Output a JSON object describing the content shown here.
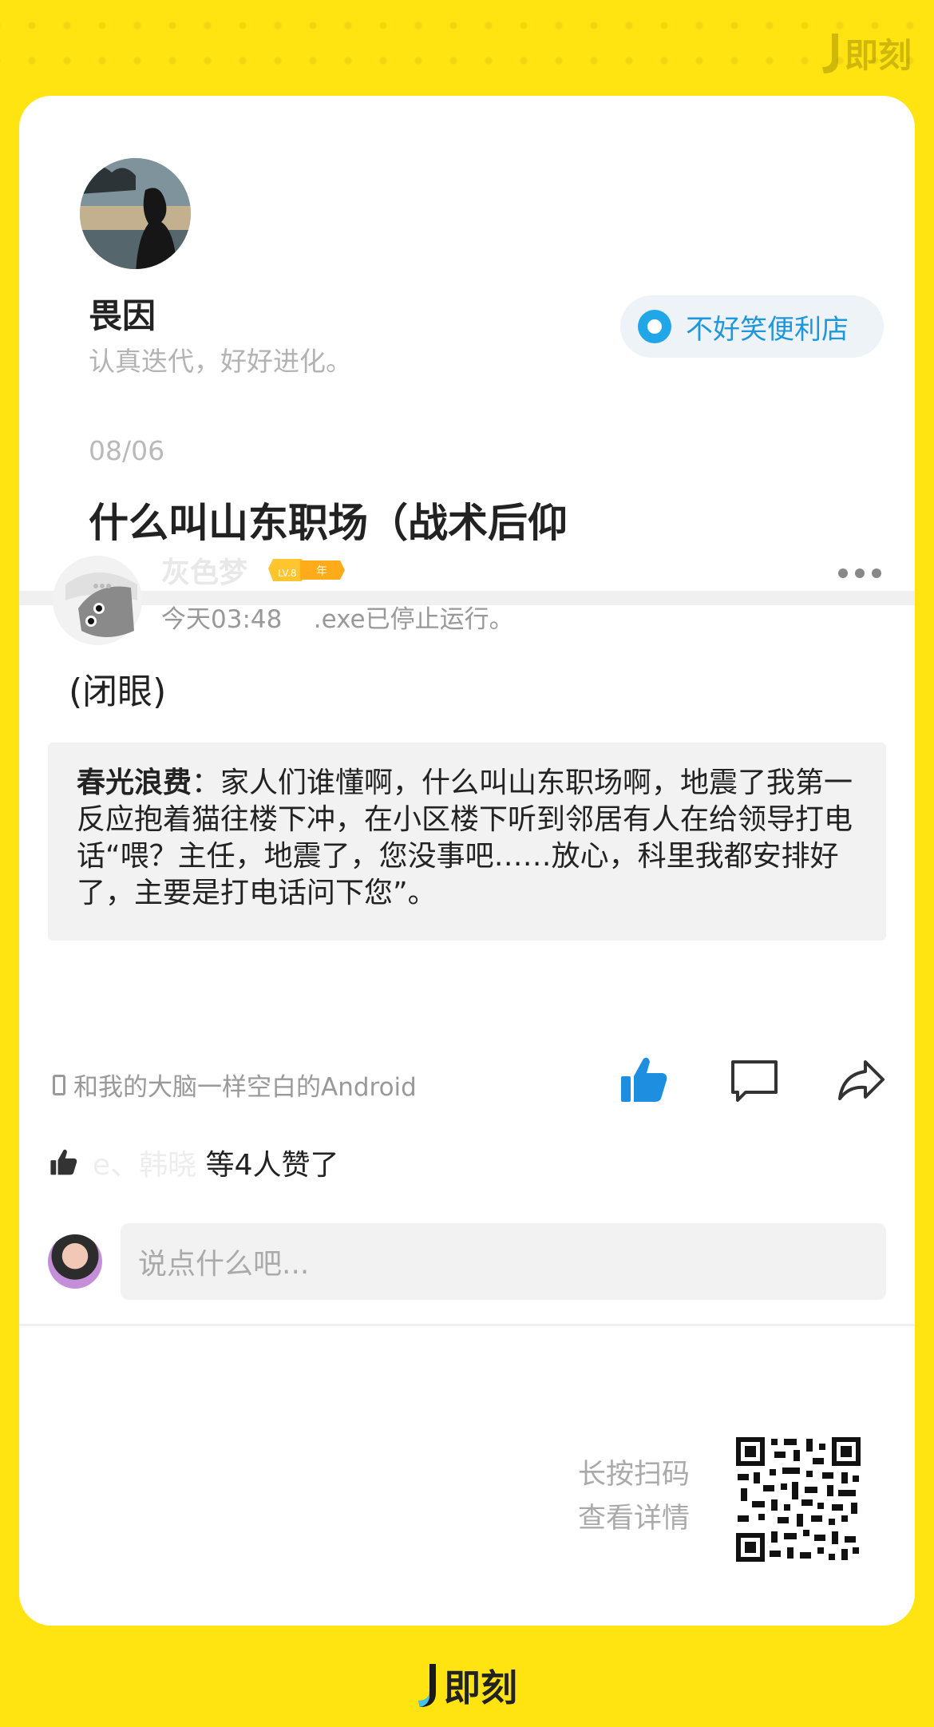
{
  "brand": {
    "name": "即刻"
  },
  "post": {
    "author": {
      "name": "畏因",
      "bio": "认真迭代，好好进化。"
    },
    "topic": "不好笑便利店",
    "date": "08/06",
    "title": "什么叫山东职场（战术后仰"
  },
  "comment": {
    "user": {
      "name": "灰色梦",
      "level": "LV.8",
      "badge": "年"
    },
    "time": "今天03:48",
    "status": ".exe已停止运行。",
    "text": "(闭眼)",
    "quote": {
      "name": "春光浪费",
      "sep": "：",
      "text": "家人们谁懂啊，什么叫山东职场啊，地震了我第一反应抱着猫往楼下冲，在小区楼下听到邻居有人在给领导打电话“喂？主任，地震了，您没事吧……放心，科里我都安排好了，主要是打电话问下您”。"
    },
    "device": "和我的大脑一样空白的Android",
    "likes": {
      "names": "e、韩晓",
      "suffix": "等4人赞了"
    }
  },
  "reply": {
    "placeholder": "说点什么吧..."
  },
  "qr_hint": {
    "line1": "长按扫码",
    "line2": "查看详情"
  },
  "colors": {
    "background": "#FFE411",
    "accent": "#21a7e8",
    "like": "#1e8ee0"
  }
}
